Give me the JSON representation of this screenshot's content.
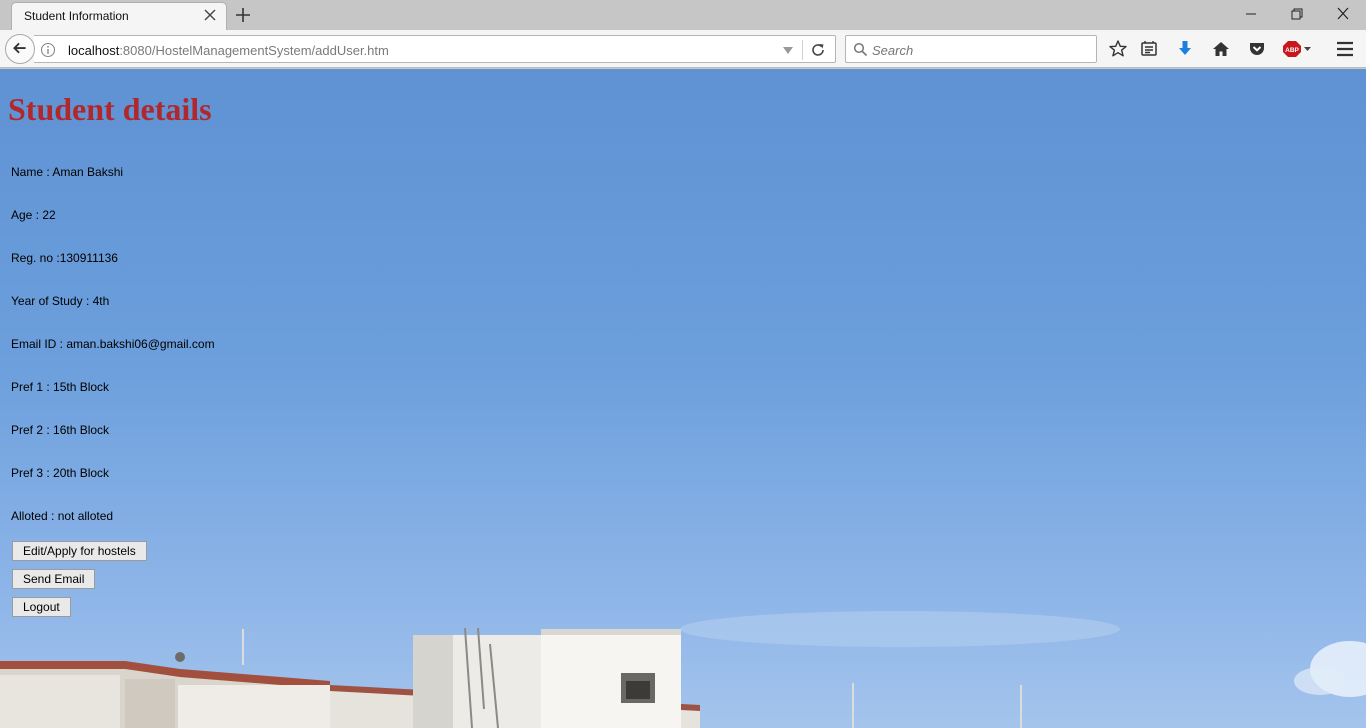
{
  "browser": {
    "tab_title": "Student Information",
    "url_host": "localhost",
    "url_rest": ":8080/HostelManagementSystem/addUser.htm",
    "search_placeholder": "Search",
    "toolbar_icons": [
      "bookmark-star-icon",
      "reading-list-icon",
      "download-icon",
      "home-icon",
      "pocket-icon",
      "adblock-icon",
      "menu-icon"
    ],
    "adblock_label": "ABP"
  },
  "page": {
    "title": "Student details",
    "fields": [
      "Name : Aman Bakshi",
      "Age : 22",
      "Reg. no :130911136",
      "Year of Study : 4th",
      "Email ID : aman.bakshi06@gmail.com",
      "Pref 1 : 15th Block",
      "Pref 2 : 16th Block",
      "Pref 3 : 20th Block",
      "Alloted : not alloted"
    ],
    "buttons": {
      "edit_apply": "Edit/Apply for hostels",
      "send_email": "Send Email",
      "logout": "Logout"
    }
  },
  "colors": {
    "title_red": "#b0282c",
    "sky_blue": "#6c9fdc",
    "download_blue": "#1a7fe0",
    "abp_red": "#c8161d"
  }
}
